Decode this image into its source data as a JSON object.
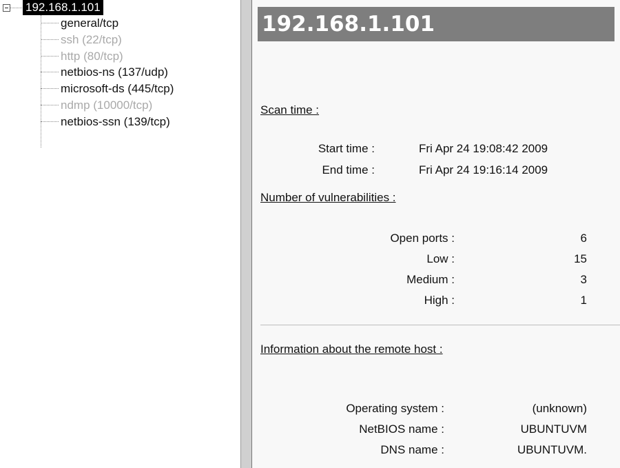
{
  "tree": {
    "root_label": "192.168.1.101",
    "items": [
      {
        "label": "general/tcp",
        "dim": false
      },
      {
        "label": "ssh (22/tcp)",
        "dim": true
      },
      {
        "label": "http (80/tcp)",
        "dim": true
      },
      {
        "label": "netbios-ns (137/udp)",
        "dim": false
      },
      {
        "label": "microsoft-ds (445/tcp)",
        "dim": false
      },
      {
        "label": "ndmp (10000/tcp)",
        "dim": true
      },
      {
        "label": "netbios-ssn (139/tcp)",
        "dim": false
      }
    ]
  },
  "report": {
    "title": "192.168.1.101",
    "scan_time": {
      "heading": "Scan time :",
      "start_label": "Start time :",
      "start_value": "Fri Apr 24 19:08:42 2009",
      "end_label": "End time :",
      "end_value": "Fri Apr 24 19:16:14 2009"
    },
    "vulnerabilities": {
      "heading": "Number of vulnerabilities :",
      "rows": [
        {
          "label": "Open ports :",
          "value": "6"
        },
        {
          "label": "Low :",
          "value": "15"
        },
        {
          "label": "Medium :",
          "value": "3"
        },
        {
          "label": "High :",
          "value": "1"
        }
      ]
    },
    "remote_host": {
      "heading": "Information about the remote host :",
      "rows": [
        {
          "label": "Operating system :",
          "value": "(unknown)"
        },
        {
          "label": "NetBIOS name :",
          "value": "UBUNTUVM"
        },
        {
          "label": "DNS name :",
          "value": "UBUNTUVM."
        }
      ]
    }
  }
}
